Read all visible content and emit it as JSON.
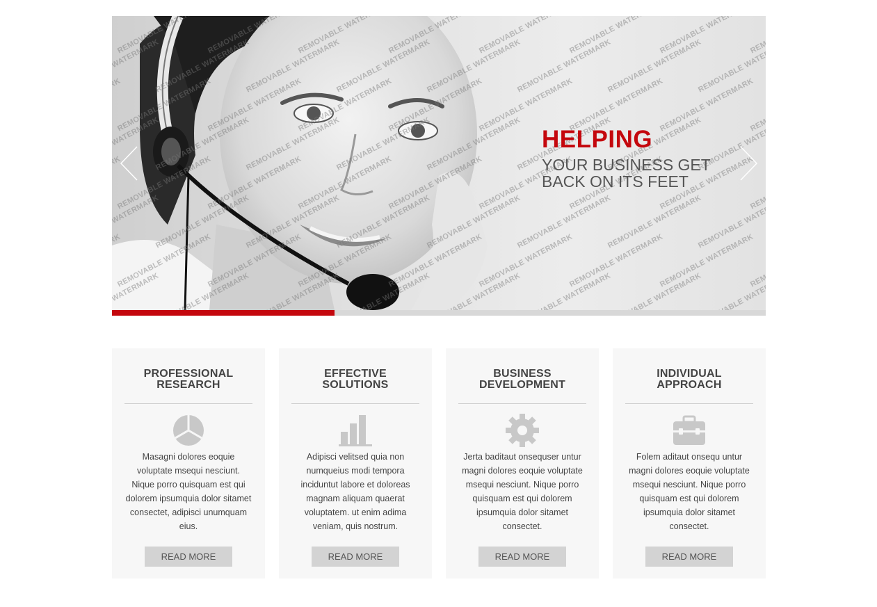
{
  "slider": {
    "headline": "HELPING",
    "subheadline": "YOUR BUSINESS GET BACK ON ITS FEET",
    "watermark": "REMOVABLE WATERMARK",
    "progress": 0.34,
    "accent_color": "#c4070d",
    "prev_icon": "chevron-left-icon",
    "next_icon": "chevron-right-icon"
  },
  "features": [
    {
      "title": "PROFESSIONAL RESEARCH",
      "icon": "pie-chart-icon",
      "text": "Masagni dolores eoquie voluptate msequi nesciunt. Nique porro quisquam est qui dolorem ipsumquia dolor sitamet consectet, adipisci unumquam eius.",
      "button": "READ MORE"
    },
    {
      "title": "EFFECTIVE SOLUTIONS",
      "icon": "bar-chart-icon",
      "text": "Adipisci velitsed quia non numqueius modi tempora inciduntut labore et doloreas magnam aliquam quaerat voluptatem. ut enim adima veniam, quis nostrum.",
      "button": "READ MORE"
    },
    {
      "title": "BUSINESS DEVELOPMENT",
      "icon": "gear-icon",
      "text": "Jerta baditaut onsequser untur magni dolores eoquie voluptate msequi nesciunt. Nique porro quisquam est qui dolorem ipsumquia dolor sitamet consectet.",
      "button": "READ MORE"
    },
    {
      "title": "INDIVIDUAL APPROACH",
      "icon": "toolbox-icon",
      "text": "Folem aditaut onsequ untur magni dolores eoquie voluptate msequi nesciunt. Nique porro quisquam est qui dolorem ipsumquia dolor sitamet consectet.",
      "button": "READ MORE"
    }
  ]
}
